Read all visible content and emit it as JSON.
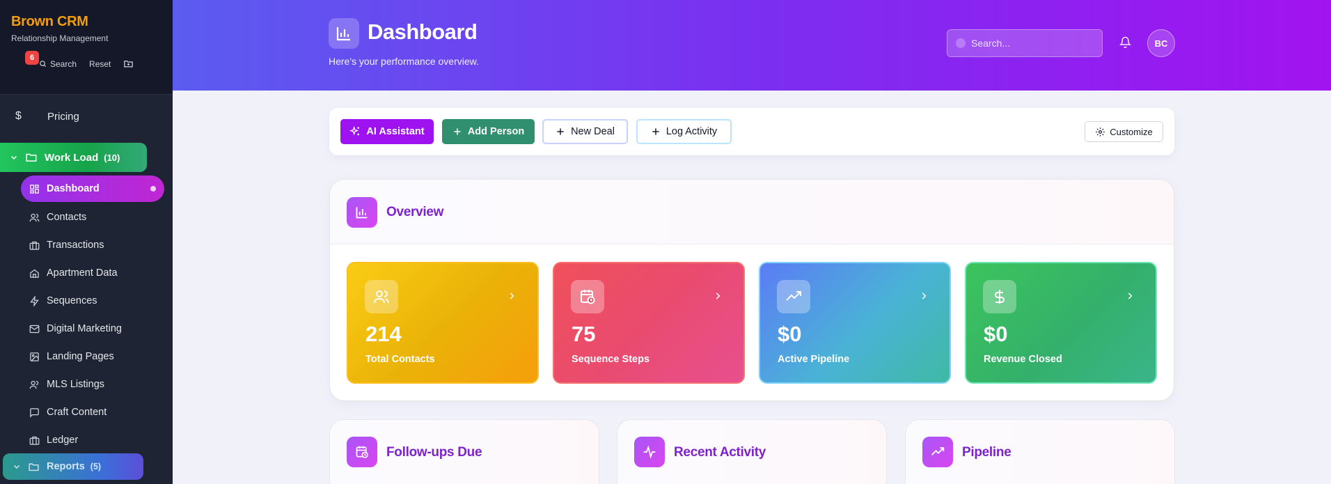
{
  "sidebar": {
    "brand": "Brown CRM",
    "subtitle": "Relationship Management",
    "notification_count": "6",
    "search_label": "Search",
    "reset_label": "Reset",
    "pricing_label": "Pricing",
    "group": {
      "label": "Work Load",
      "count": "(10)"
    },
    "items": [
      {
        "label": "Dashboard",
        "icon": "dashboard-icon"
      },
      {
        "label": "Contacts",
        "icon": "users-icon"
      },
      {
        "label": "Transactions",
        "icon": "briefcase-icon"
      },
      {
        "label": "Apartment Data",
        "icon": "home-icon"
      },
      {
        "label": "Sequences",
        "icon": "zap-icon"
      },
      {
        "label": "Digital Marketing",
        "icon": "mail-icon"
      },
      {
        "label": "Landing Pages",
        "icon": "image-icon"
      },
      {
        "label": "MLS Listings",
        "icon": "user-icon"
      },
      {
        "label": "Craft Content",
        "icon": "message-icon"
      },
      {
        "label": "Ledger",
        "icon": "briefcase-icon"
      }
    ],
    "group2": {
      "label": "Reports",
      "count": "(5)"
    }
  },
  "header": {
    "title": "Dashboard",
    "subtitle": "Here's your performance overview.",
    "search_placeholder": "Search...",
    "avatar_initials": "BC"
  },
  "actions": {
    "ai": "AI Assistant",
    "add_person": "Add Person",
    "new_deal": "New Deal",
    "log_activity": "Log Activity",
    "customize": "Customize"
  },
  "overview": {
    "title": "Overview",
    "cards": [
      {
        "value": "214",
        "label": "Total Contacts"
      },
      {
        "value": "75",
        "label": "Sequence Steps"
      },
      {
        "value": "$0",
        "label": "Active Pipeline"
      },
      {
        "value": "$0",
        "label": "Revenue Closed"
      }
    ]
  },
  "panels": {
    "followups": "Follow-ups Due",
    "activity": "Recent Activity",
    "pipeline": "Pipeline"
  },
  "colors": {
    "accent_purple": "#9e12f0",
    "green": "#2f8f6e",
    "sidebar_bg": "#1e2433",
    "brand": "#f59e0b"
  }
}
